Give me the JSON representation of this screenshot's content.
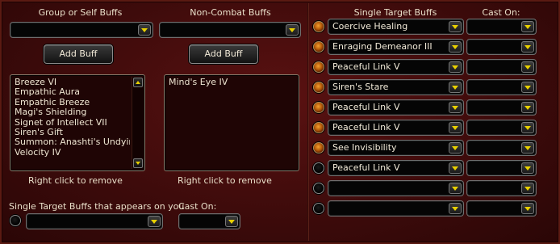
{
  "group_buffs": {
    "header": "Group or Self Buffs",
    "selected": "",
    "add_button": "Add Buff",
    "list": [
      "Breeze VI",
      "Empathic Aura",
      "Empathic Breeze",
      "Magi's Shielding",
      "Signet of Intellect VII",
      "Siren's Gift",
      "Summon: Anashti's Undying",
      "Velocity IV"
    ],
    "hint": "Right click to remove"
  },
  "noncombat_buffs": {
    "header": "Non-Combat Buffs",
    "selected": "",
    "add_button": "Add Buff",
    "list": [
      "Mind's Eye IV"
    ],
    "hint": "Right click to remove"
  },
  "single_self": {
    "label": "Single Target Buffs that appears on you",
    "selected": "",
    "cast_on_label": "Cast On:",
    "cast_on_value": ""
  },
  "single_target": {
    "header": "Single Target Buffs",
    "cast_on_header": "Cast On:",
    "rows": [
      {
        "buff": "Coercive Healing",
        "cast_on": "",
        "enabled": true
      },
      {
        "buff": "Enraging Demeanor III",
        "cast_on": "",
        "enabled": true
      },
      {
        "buff": "Peaceful Link V",
        "cast_on": "",
        "enabled": true
      },
      {
        "buff": "Siren's Stare",
        "cast_on": "",
        "enabled": true
      },
      {
        "buff": "Peaceful Link V",
        "cast_on": "",
        "enabled": true
      },
      {
        "buff": "Peaceful Link V",
        "cast_on": "",
        "enabled": true
      },
      {
        "buff": "See Invisibility",
        "cast_on": "",
        "enabled": true
      },
      {
        "buff": "Peaceful Link V",
        "cast_on": "",
        "enabled": false
      },
      {
        "buff": "",
        "cast_on": "",
        "enabled": false
      },
      {
        "buff": "",
        "cast_on": "",
        "enabled": false
      }
    ]
  },
  "colors": {
    "background": "#3e0b0b",
    "radio_on": "#d9801a",
    "dropdown_arrow": "#e8d000"
  },
  "icons": {
    "dropdown": "chevron-down-icon",
    "scroll_up": "arrow-up-icon",
    "scroll_down": "arrow-down-icon"
  }
}
